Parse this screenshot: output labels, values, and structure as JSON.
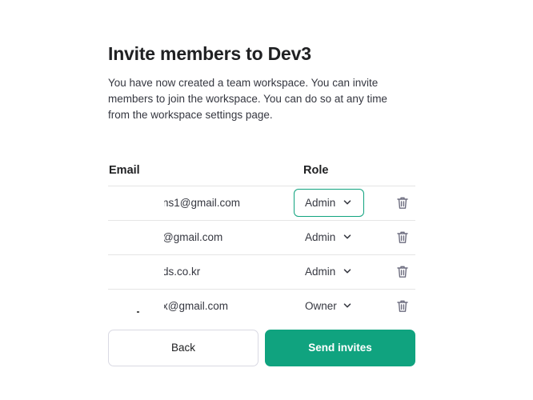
{
  "dialog": {
    "title": "Invite members to Dev3",
    "description": "You have now created a team workspace. You can invite members to join the workspace. You can do so at any time from the workspace settings page."
  },
  "table": {
    "columns": {
      "email": "Email",
      "role": "Role"
    },
    "rows": [
      {
        "email": "ns1@gmail.com",
        "role": "Admin",
        "focused": true
      },
      {
        "email": "@gmail.com",
        "role": "Admin",
        "focused": false
      },
      {
        "email": "ds.co.kr",
        "role": "Admin",
        "focused": false
      },
      {
        "email": "x@gmail.com",
        "role": "Owner",
        "focused": false
      }
    ]
  },
  "buttons": {
    "back": "Back",
    "send": "Send invites"
  },
  "colors": {
    "accent": "#10a37f",
    "border": "#e5e5e5"
  },
  "icons": {
    "role_dropdown": "chevron-down-icon",
    "delete": "trash-icon"
  }
}
